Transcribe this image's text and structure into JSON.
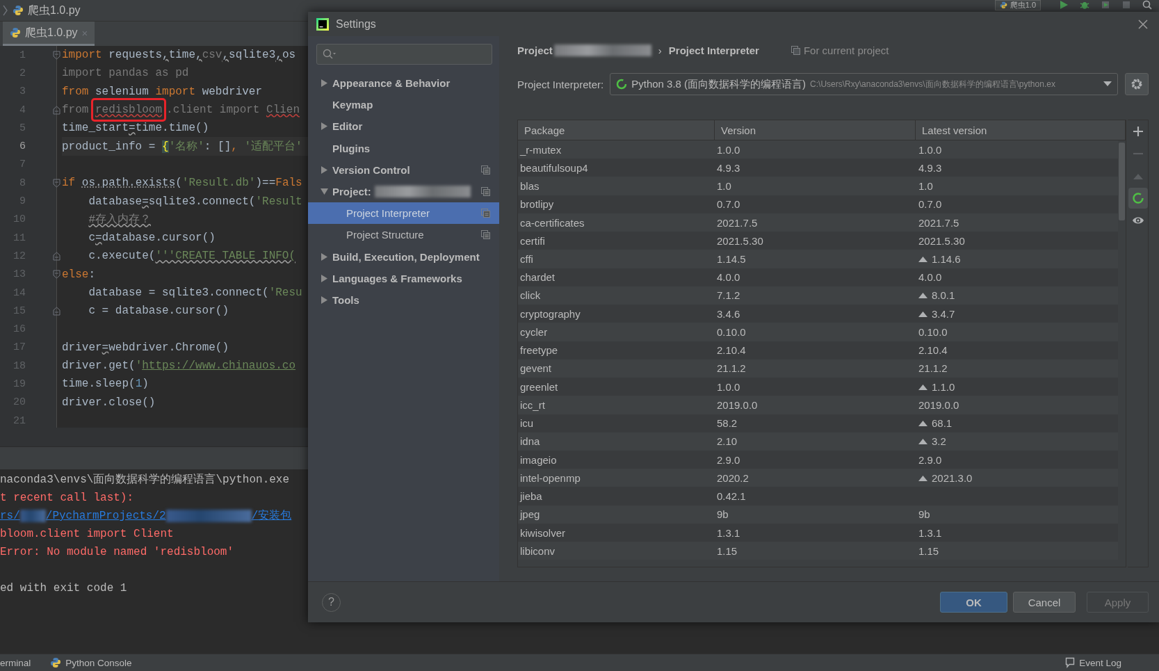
{
  "editor": {
    "nav_file": "爬虫1.0.py",
    "run_config": "爬虫1.0",
    "tabs": [
      {
        "label": "爬虫1.0.py",
        "close": "×",
        "selected": true
      }
    ],
    "lines": [
      {
        "number": "1",
        "current": false,
        "indented": false,
        "fold_start": true,
        "fold_end": false,
        "tokens": [
          {
            "kind": "kw",
            "text": "import"
          },
          {
            "kind": "id",
            "text": " requests"
          },
          {
            "kind": "opw",
            "text": ","
          },
          {
            "kind": "id",
            "text": "time"
          },
          {
            "kind": "opw",
            "text": ","
          },
          {
            "kind": "muted",
            "text": "csv"
          },
          {
            "kind": "opw",
            "text": ","
          },
          {
            "kind": "id",
            "text": "sqlite3"
          },
          {
            "kind": "opw",
            "text": ","
          },
          {
            "kind": "id",
            "text": "os"
          }
        ]
      },
      {
        "number": "2",
        "current": false,
        "indented": false,
        "fold_start": false,
        "fold_end": false,
        "tokens": [
          {
            "kind": "muted",
            "text": "import pandas as pd"
          }
        ]
      },
      {
        "number": "3",
        "current": false,
        "indented": false,
        "fold_start": false,
        "fold_end": false,
        "tokens": [
          {
            "kind": "kw",
            "text": "from"
          },
          {
            "kind": "id",
            "text": " selenium "
          },
          {
            "kind": "kw",
            "text": "import"
          },
          {
            "kind": "id",
            "text": " webdriver"
          }
        ]
      },
      {
        "number": "4",
        "current": false,
        "indented": false,
        "fold_start": false,
        "fold_end": true,
        "tokens": [
          {
            "kind": "muted",
            "text": "from "
          },
          {
            "kind": "boxed",
            "text": "redisbloom"
          },
          {
            "kind": "muted",
            "text": ".client import "
          },
          {
            "kind": "merr",
            "text": "Clien"
          }
        ]
      },
      {
        "number": "5",
        "current": false,
        "indented": false,
        "fold_start": false,
        "fold_end": false,
        "tokens": [
          {
            "kind": "id",
            "text": "time_start"
          },
          {
            "kind": "opw",
            "text": "="
          },
          {
            "kind": "id",
            "text": "time.time()"
          }
        ]
      },
      {
        "number": "6",
        "current": true,
        "indented": false,
        "fold_start": false,
        "fold_end": false,
        "tokens": [
          {
            "kind": "id",
            "text": "product_info = "
          },
          {
            "kind": "brace",
            "text": "{"
          },
          {
            "kind": "str",
            "text": "'名称'"
          },
          {
            "kind": "id",
            "text": ": []"
          },
          {
            "kind": "kw",
            "text": ", "
          },
          {
            "kind": "str",
            "text": "'适配平台'"
          }
        ]
      },
      {
        "number": "7",
        "current": false,
        "fold_start": false,
        "fold_end": false
      },
      {
        "number": "8",
        "current": false,
        "indented": false,
        "fold_start": true,
        "fold_end": false,
        "tokens": [
          {
            "kind": "kw",
            "text": "if "
          },
          {
            "kind": "idw",
            "text": "os.path.exists"
          },
          {
            "kind": "id",
            "text": "("
          },
          {
            "kind": "str",
            "text": "'Result.db'"
          },
          {
            "kind": "id",
            "text": ")=="
          },
          {
            "kind": "kw",
            "text": "Fals"
          }
        ]
      },
      {
        "number": "9",
        "current": false,
        "indented": true,
        "fold_start": false,
        "fold_end": false,
        "tokens": [
          {
            "kind": "id",
            "text": "database"
          },
          {
            "kind": "opw",
            "text": "="
          },
          {
            "kind": "id",
            "text": "sqlite3.connect("
          },
          {
            "kind": "str",
            "text": "'Result"
          }
        ]
      },
      {
        "number": "10",
        "current": false,
        "indented": true,
        "fold_start": false,
        "fold_end": false,
        "tokens": [
          {
            "kind": "cw",
            "text": "#存入内存？"
          }
        ]
      },
      {
        "number": "11",
        "current": false,
        "indented": true,
        "fold_start": false,
        "fold_end": false,
        "tokens": [
          {
            "kind": "id",
            "text": "c"
          },
          {
            "kind": "opw",
            "text": "="
          },
          {
            "kind": "id",
            "text": "database.cursor()"
          }
        ]
      },
      {
        "number": "12",
        "current": false,
        "indented": true,
        "fold_start": false,
        "fold_end": true,
        "tokens": [
          {
            "kind": "id",
            "text": "c.execute("
          },
          {
            "kind": "strw",
            "text": "'''CREATE TABLE INFO("
          }
        ]
      },
      {
        "number": "13",
        "current": false,
        "indented": false,
        "fold_start": true,
        "fold_end": false,
        "tokens": [
          {
            "kind": "kw",
            "text": "else"
          },
          {
            "kind": "id",
            "text": ":"
          }
        ]
      },
      {
        "number": "14",
        "current": false,
        "indented": true,
        "fold_start": false,
        "fold_end": false,
        "tokens": [
          {
            "kind": "id",
            "text": "database = sqlite3.connect("
          },
          {
            "kind": "str",
            "text": "'Resu"
          }
        ]
      },
      {
        "number": "15",
        "current": false,
        "indented": true,
        "fold_start": false,
        "fold_end": true,
        "tokens": [
          {
            "kind": "id",
            "text": "c = database.cursor()"
          }
        ]
      },
      {
        "number": "16",
        "current": false,
        "fold_start": false,
        "fold_end": false
      },
      {
        "number": "17",
        "current": false,
        "indented": false,
        "fold_start": false,
        "fold_end": false,
        "tokens": [
          {
            "kind": "id",
            "text": "driver"
          },
          {
            "kind": "opw",
            "text": "="
          },
          {
            "kind": "id",
            "text": "webdriver.Chrome()"
          }
        ]
      },
      {
        "number": "18",
        "current": false,
        "indented": false,
        "fold_start": false,
        "fold_end": false,
        "tokens": [
          {
            "kind": "id",
            "text": "driver.get("
          },
          {
            "kind": "str",
            "text": "'"
          },
          {
            "kind": "link",
            "text": "https://www.chinauos.co"
          }
        ]
      },
      {
        "number": "19",
        "current": false,
        "indented": false,
        "fold_start": false,
        "fold_end": false,
        "tokens": [
          {
            "kind": "id",
            "text": "time.sleep("
          },
          {
            "kind": "num",
            "text": "1"
          },
          {
            "kind": "id",
            "text": ")"
          }
        ]
      },
      {
        "number": "20",
        "current": false,
        "indented": false,
        "fold_start": false,
        "fold_end": false,
        "tokens": [
          {
            "kind": "id",
            "text": "driver.close()"
          }
        ]
      },
      {
        "number": "21",
        "current": false,
        "fold_start": false,
        "fold_end": false
      }
    ]
  },
  "console": {
    "lines": [
      {
        "kind": "stdout",
        "parts": [
          {
            "kind": "text",
            "text": "naconda3\\envs\\面向数据科学的编程语言\\python.exe"
          }
        ]
      },
      {
        "kind": "stderr",
        "parts": [
          {
            "kind": "text",
            "text": "t recent call last):"
          }
        ]
      },
      {
        "kind": "link",
        "parts": [
          {
            "kind": "text",
            "text": "rs/"
          },
          {
            "kind": "redacted-short"
          },
          {
            "kind": "text",
            "text": "/PycharmProjects/2"
          },
          {
            "kind": "redacted-long"
          },
          {
            "kind": "text",
            "text": "/安装包"
          }
        ]
      },
      {
        "kind": "stderr",
        "parts": [
          {
            "kind": "text",
            "text": "bloom.client import Client"
          }
        ]
      },
      {
        "kind": "stderr",
        "parts": [
          {
            "kind": "text",
            "text": "Error: No module named 'redisbloom'"
          }
        ]
      },
      {
        "kind": "blank"
      },
      {
        "kind": "stdout",
        "parts": [
          {
            "kind": "text",
            "text": "ed with exit code 1"
          }
        ]
      }
    ]
  },
  "bottom_bar": {
    "tabs": [
      {
        "label": "erminal",
        "kind": "terminal"
      },
      {
        "label": "Python Console",
        "kind": "python"
      }
    ],
    "event_log": "Event Log"
  },
  "settings": {
    "title": "Settings",
    "tree": [
      {
        "label": "Appearance & Behavior",
        "kind": "group",
        "expanded": false,
        "selected": false,
        "redacted": false,
        "project_scoped": false
      },
      {
        "label": "Keymap",
        "kind": "page",
        "selected": false,
        "redacted": false,
        "project_scoped": false
      },
      {
        "label": "Editor",
        "kind": "group",
        "expanded": false,
        "selected": false,
        "redacted": false,
        "project_scoped": false
      },
      {
        "label": "Plugins",
        "kind": "page",
        "selected": false,
        "redacted": false,
        "project_scoped": false
      },
      {
        "label": "Version Control",
        "kind": "group",
        "expanded": false,
        "selected": false,
        "redacted": false,
        "project_scoped": true
      },
      {
        "label": "Project:",
        "kind": "group",
        "expanded": true,
        "selected": false,
        "redacted": true,
        "project_scoped": true,
        "children": [
          {
            "label": "Project Interpreter",
            "kind": "page",
            "selected": true,
            "redacted": false,
            "project_scoped": true
          },
          {
            "label": "Project Structure",
            "kind": "page",
            "selected": false,
            "redacted": false,
            "project_scoped": true
          }
        ]
      },
      {
        "label": "Build, Execution, Deployment",
        "kind": "group",
        "expanded": false,
        "selected": false,
        "redacted": false,
        "project_scoped": false
      },
      {
        "label": "Languages & Frameworks",
        "kind": "group",
        "expanded": false,
        "selected": false,
        "redacted": false,
        "project_scoped": false
      },
      {
        "label": "Tools",
        "kind": "group",
        "expanded": false,
        "selected": false,
        "redacted": false,
        "project_scoped": false
      }
    ],
    "breadcrumb": {
      "items": [
        {
          "label": "Project",
          "redacted": true
        },
        {
          "label": "Project Interpreter",
          "redacted": false
        }
      ],
      "separator": "›",
      "scope": "For current project"
    },
    "interpreter": {
      "label": "Project Interpreter:",
      "name": "Python 3.8 (面向数据科学的编程语言)",
      "path": "C:\\Users\\Rxy\\anaconda3\\envs\\面向数据科学的编程语言\\python.ex"
    },
    "table": {
      "columns": [
        "Package",
        "Version",
        "Latest version"
      ],
      "rows": [
        {
          "package": "_r-mutex",
          "version": "1.0.0",
          "latest": "1.0.0",
          "upgrade": false
        },
        {
          "package": "beautifulsoup4",
          "version": "4.9.3",
          "latest": "4.9.3",
          "upgrade": false
        },
        {
          "package": "blas",
          "version": "1.0",
          "latest": "1.0",
          "upgrade": false
        },
        {
          "package": "brotlipy",
          "version": "0.7.0",
          "latest": "0.7.0",
          "upgrade": false
        },
        {
          "package": "ca-certificates",
          "version": "2021.7.5",
          "latest": "2021.7.5",
          "upgrade": false
        },
        {
          "package": "certifi",
          "version": "2021.5.30",
          "latest": "2021.5.30",
          "upgrade": false
        },
        {
          "package": "cffi",
          "version": "1.14.5",
          "latest": "1.14.6",
          "upgrade": true
        },
        {
          "package": "chardet",
          "version": "4.0.0",
          "latest": "4.0.0",
          "upgrade": false
        },
        {
          "package": "click",
          "version": "7.1.2",
          "latest": "8.0.1",
          "upgrade": true
        },
        {
          "package": "cryptography",
          "version": "3.4.6",
          "latest": "3.4.7",
          "upgrade": true
        },
        {
          "package": "cycler",
          "version": "0.10.0",
          "latest": "0.10.0",
          "upgrade": false
        },
        {
          "package": "freetype",
          "version": "2.10.4",
          "latest": "2.10.4",
          "upgrade": false
        },
        {
          "package": "gevent",
          "version": "21.1.2",
          "latest": "21.1.2",
          "upgrade": false
        },
        {
          "package": "greenlet",
          "version": "1.0.0",
          "latest": "1.1.0",
          "upgrade": true
        },
        {
          "package": "icc_rt",
          "version": "2019.0.0",
          "latest": "2019.0.0",
          "upgrade": false
        },
        {
          "package": "icu",
          "version": "58.2",
          "latest": "68.1",
          "upgrade": true
        },
        {
          "package": "idna",
          "version": "2.10",
          "latest": "3.2",
          "upgrade": true
        },
        {
          "package": "imageio",
          "version": "2.9.0",
          "latest": "2.9.0",
          "upgrade": false
        },
        {
          "package": "intel-openmp",
          "version": "2020.2",
          "latest": "2021.3.0",
          "upgrade": true
        },
        {
          "package": "jieba",
          "version": "0.42.1",
          "upgrade": false
        },
        {
          "package": "jpeg",
          "version": "9b",
          "latest": "9b",
          "upgrade": false
        },
        {
          "package": "kiwisolver",
          "version": "1.3.1",
          "latest": "1.3.1",
          "upgrade": false
        },
        {
          "package": "libiconv",
          "version": "1.15",
          "latest": "1.15",
          "upgrade": false
        }
      ]
    },
    "toolbar": [
      {
        "kind": "add",
        "disabled": false,
        "selected": false
      },
      {
        "kind": "remove",
        "disabled": true,
        "selected": false
      },
      {
        "kind": "upgrade",
        "disabled": true,
        "selected": false
      },
      {
        "kind": "refresh",
        "disabled": false,
        "selected": true
      },
      {
        "kind": "show",
        "disabled": false,
        "selected": false
      }
    ],
    "help": "?",
    "buttons": [
      {
        "label": "OK",
        "kind": "default",
        "disabled": false
      },
      {
        "label": "Cancel",
        "kind": "normal",
        "disabled": false
      },
      {
        "label": "Apply",
        "kind": "normal",
        "disabled": true
      }
    ]
  }
}
